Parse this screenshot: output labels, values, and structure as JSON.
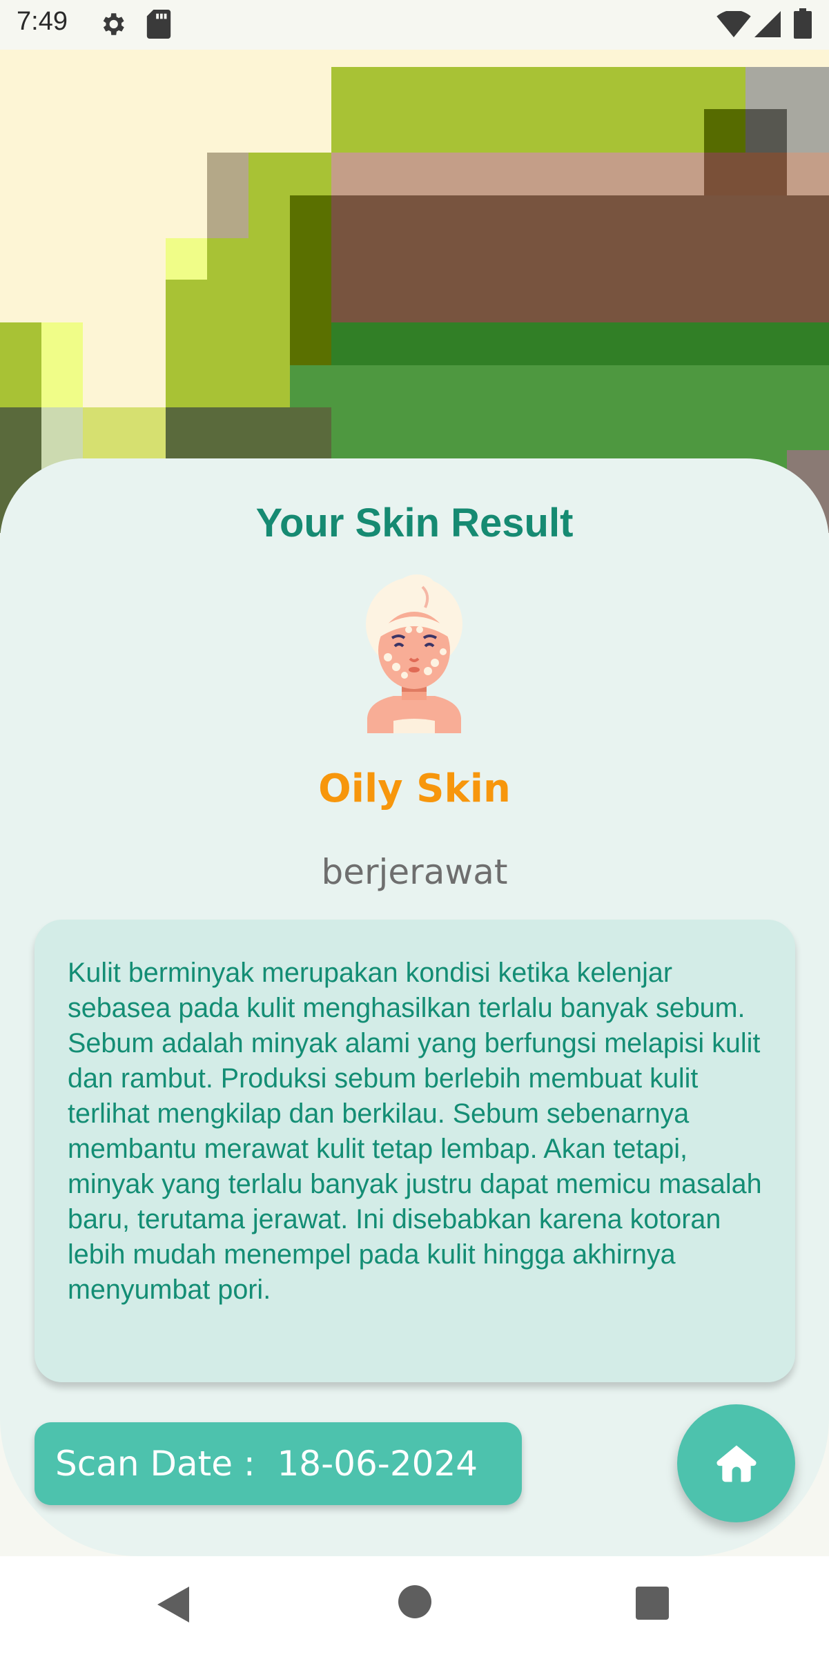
{
  "status_bar": {
    "time": "7:49",
    "icons": [
      "gear-icon",
      "sd-card-icon",
      "wifi-icon",
      "signal-icon",
      "battery-icon"
    ]
  },
  "result": {
    "title": "Your Skin Result",
    "skin_type": "Oily Skin",
    "condition": "berjerawat",
    "description": "Kulit berminyak merupakan kondisi ketika kelenjar sebasea pada kulit menghasilkan terlalu banyak sebum. Sebum adalah minyak alami yang berfungsi melapisi kulit dan rambut. Produksi sebum berlebih membuat kulit terlihat mengkilap dan berkilau. Sebum sebenarnya membantu merawat kulit tetap lembap. Akan tetapi, minyak yang terlalu banyak justru dapat memicu masalah baru, terutama jerawat. Ini disebabkan karena kotoran lebih mudah menempel pada kulit hingga akhirnya menyumbat pori.",
    "scan_date": "Scan Date :  18-06-2024",
    "avatar_icon": "acne-face-avatar-icon",
    "home_icon": "home-icon"
  },
  "colors": {
    "accent": "#4dc2ad",
    "title": "#168a72",
    "skin_type": "#f7960c",
    "card": "#e8f3f0",
    "description_box": "#d3ece7"
  },
  "nav_bar": {
    "icons": [
      "back-icon",
      "home-circle-icon",
      "recents-icon"
    ]
  }
}
